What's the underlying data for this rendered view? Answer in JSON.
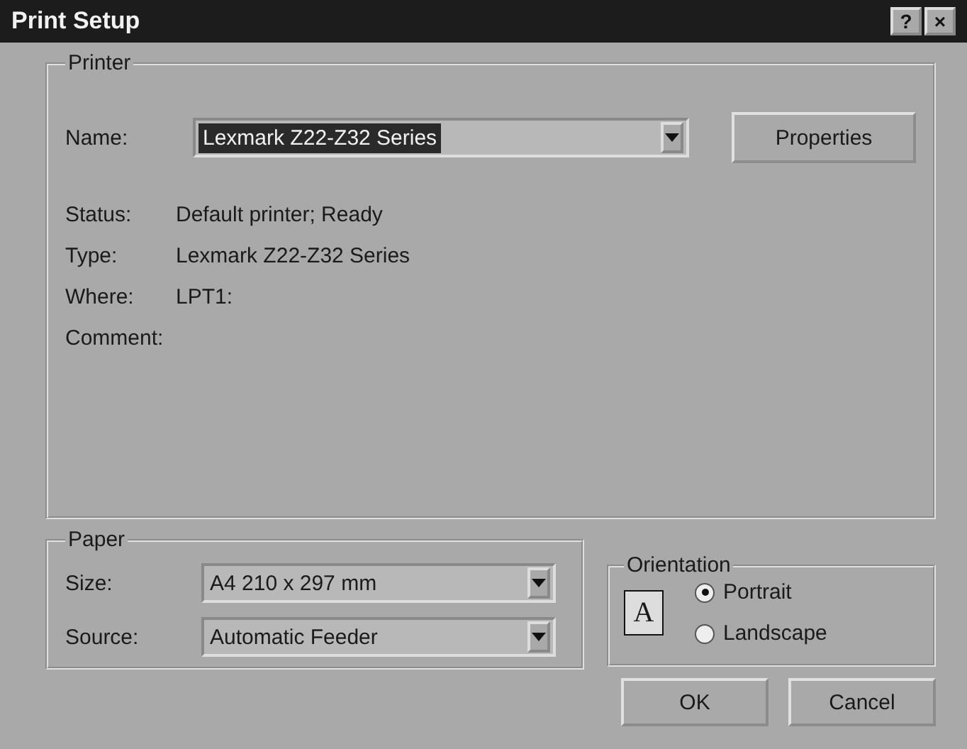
{
  "window": {
    "title": "Print Setup",
    "help_button": "?",
    "close_button": "×"
  },
  "printer": {
    "label": "Printer",
    "name_label": "Name:",
    "name_value": "Lexmark Z22-Z32 Series",
    "properties_button": "Properties",
    "info": [
      {
        "label": "Status:",
        "value": "Default printer; Ready"
      },
      {
        "label": "Type:",
        "value": "Lexmark Z22-Z32 Series"
      },
      {
        "label": "Where:",
        "value": "LPT1:"
      },
      {
        "label": "Comment:"
      }
    ]
  },
  "paper": {
    "label": "Paper",
    "fields": [
      {
        "label": "Size:",
        "value": "A4 210 x 297 mm"
      },
      {
        "label": "Source:",
        "value": "Automatic Feeder"
      }
    ]
  },
  "orientation": {
    "label": "Orientation",
    "icon_letter": "A",
    "options": [
      {
        "label": "Portrait",
        "selected": true
      },
      {
        "label": "Landscape",
        "selected": false
      }
    ]
  },
  "buttons": [
    "OK",
    "Cancel"
  ]
}
